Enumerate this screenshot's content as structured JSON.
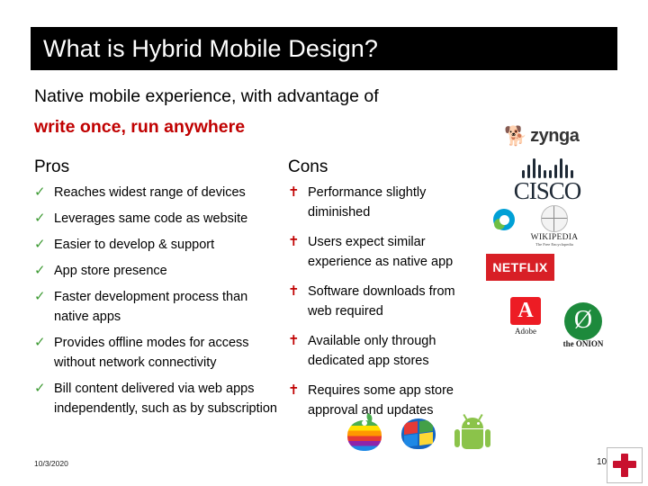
{
  "slide": {
    "title": "What is Hybrid Mobile Design?",
    "subtitle_line1": "Native mobile experience, with advantage of",
    "subtitle_line2": "write once, run anywhere",
    "pros_header": "Pros",
    "cons_header": "Cons",
    "pros": [
      "Reaches widest range of devices",
      "Leverages same code as website",
      "Easier to develop & support",
      "App store presence",
      "Faster development process than native apps",
      "Provides offline modes for access without network connectivity",
      "Bill content delivered via web apps independently, such as by subscription"
    ],
    "cons": [
      "Performance slightly diminished",
      "Users expect similar experience as native app",
      "Software downloads from web required",
      "Available only through dedicated app stores",
      "Requires some app store approval and updates"
    ],
    "footer": {
      "date": "10/3/2020",
      "slide_number": "10"
    },
    "logos": {
      "zynga": "zynga",
      "cisco": "CISCO",
      "wikipedia_name": "WIKIPEDIA",
      "wikipedia_tagline": "The Free Encyclopedia",
      "netflix": "NETFLIX",
      "adobe": "Adobe",
      "onion": "the ONION"
    },
    "colors": {
      "title_bar": "#000000",
      "accent_red": "#c00000",
      "check_green": "#3f9b35",
      "netflix_red": "#d81f26"
    }
  }
}
